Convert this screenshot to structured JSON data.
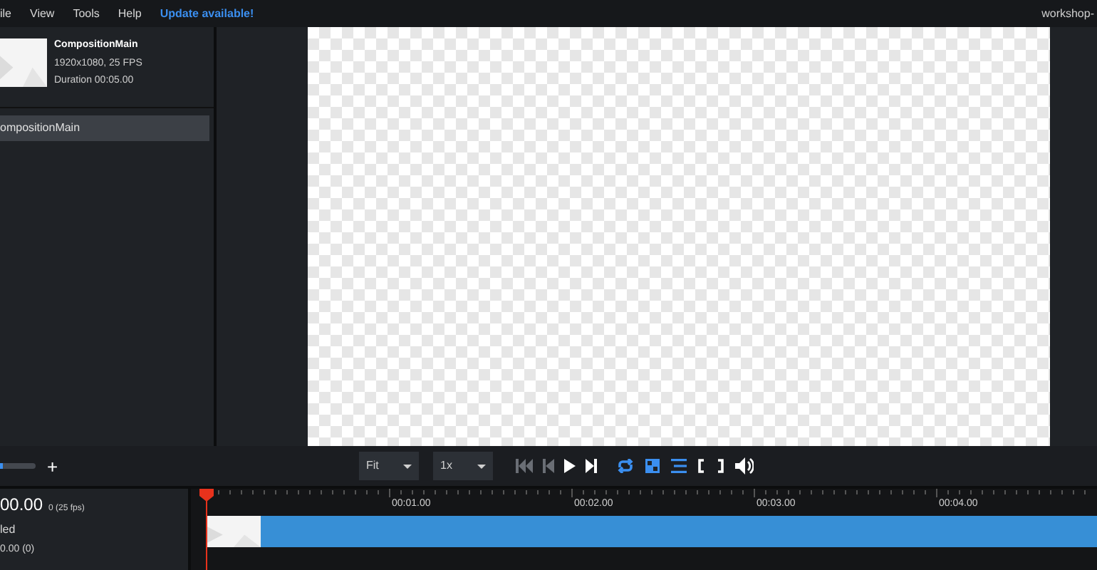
{
  "menu": [
    {
      "label": "ile",
      "kind": "item"
    },
    {
      "label": "View",
      "kind": "item"
    },
    {
      "label": "Tools",
      "kind": "item"
    },
    {
      "label": "Help",
      "kind": "item"
    },
    {
      "label": "Update available!",
      "kind": "update"
    }
  ],
  "project_name": "workshop-",
  "composition": {
    "name": "CompositionMain",
    "resolution": "1920x1080, 25 FPS",
    "duration": "Duration 00:05.00"
  },
  "compositions": [
    {
      "label": "ompositionMain",
      "selected": true
    }
  ],
  "zoom": {
    "level": 0.08
  },
  "zoom_in_label": "+",
  "fit_select": {
    "value": "Fit"
  },
  "speed_select": {
    "value": "1x"
  },
  "transport": [
    {
      "kind": "first",
      "disabled": true
    },
    {
      "kind": "prev",
      "disabled": true
    },
    {
      "kind": "play",
      "disabled": false
    },
    {
      "kind": "next",
      "disabled": false
    }
  ],
  "toggles": [
    {
      "kind": "loop",
      "on": true
    },
    {
      "kind": "grid",
      "on": true
    },
    {
      "kind": "lines",
      "on": true
    },
    {
      "kind": "mark-in",
      "on": false
    },
    {
      "kind": "mark-out",
      "on": false
    },
    {
      "kind": "volume",
      "on": false
    }
  ],
  "timeline": {
    "time": "00.00",
    "frame": "0 (25 fps)",
    "status": "led",
    "position": "0.00 (0)",
    "ticks": [
      "00:01.00",
      "00:02.00",
      "00:03.00",
      "00:04.00"
    ]
  }
}
